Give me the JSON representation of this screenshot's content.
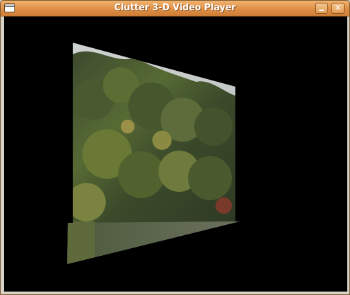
{
  "window": {
    "title": "Clutter 3-D Video Player",
    "minimize_glyph": "",
    "close_glyph": "✕"
  },
  "icons": {
    "window_menu": "window-menu-icon",
    "minimize": "minimize-icon",
    "close": "close-icon"
  },
  "colors": {
    "titlebar": "#df8f45",
    "stage_background": "#000000"
  }
}
